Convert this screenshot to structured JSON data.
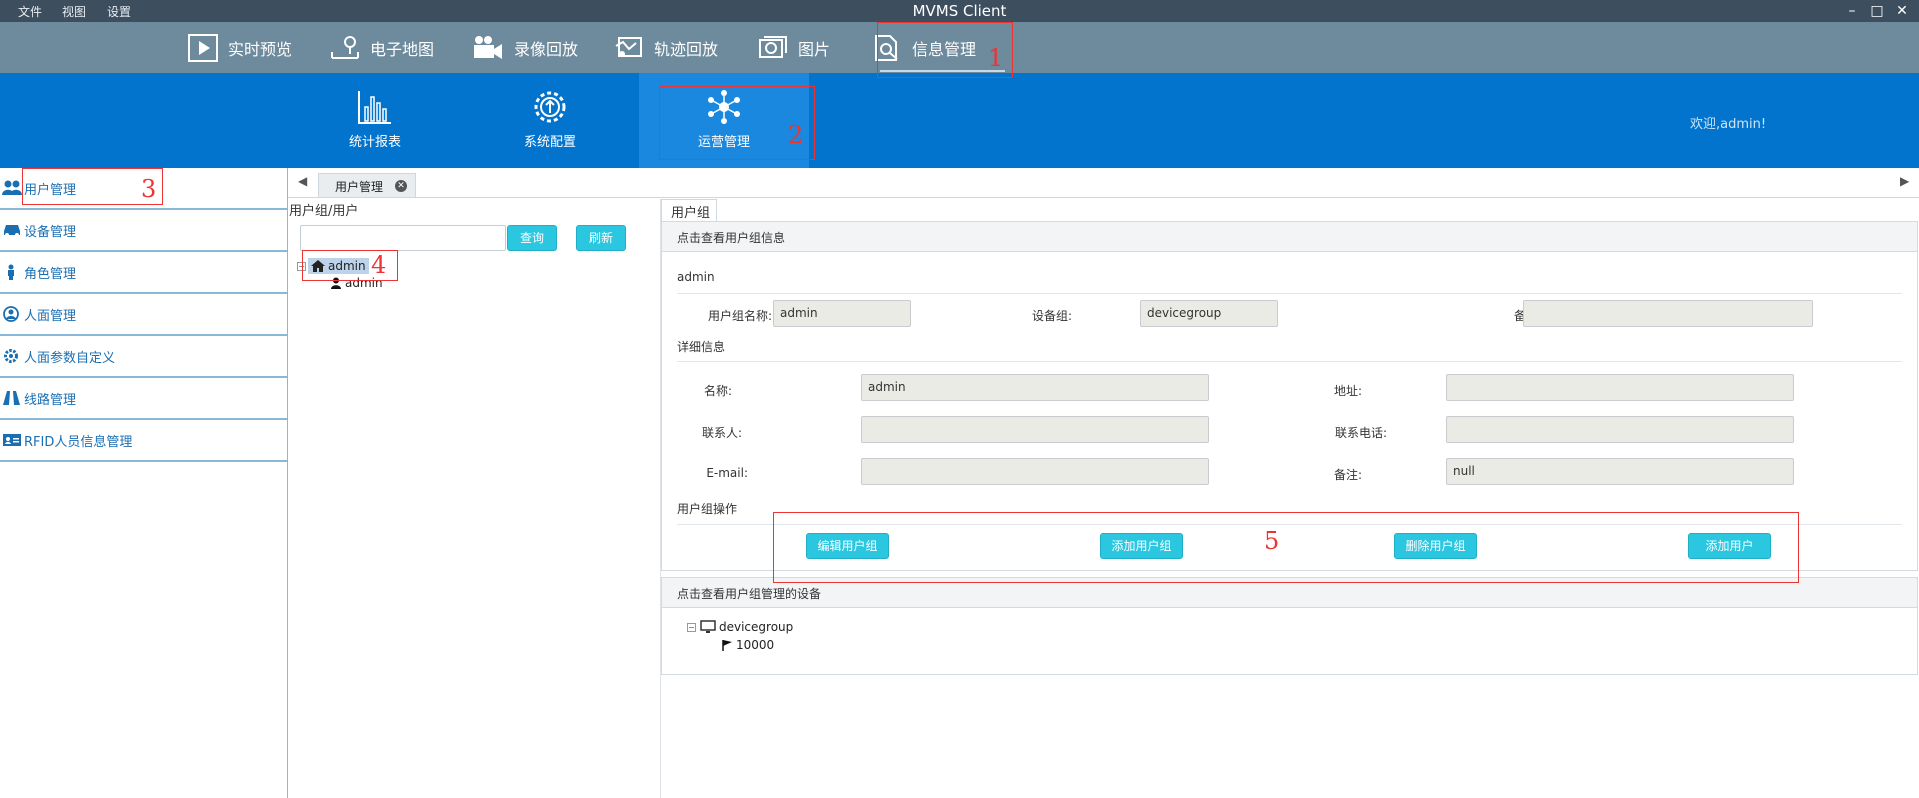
{
  "window": {
    "title": "MVMS Client",
    "menu": [
      "文件",
      "视图",
      "设置"
    ]
  },
  "topnav": {
    "items": [
      "实时预览",
      "电子地图",
      "录像回放",
      "轨迹回放",
      "图片",
      "信息管理"
    ]
  },
  "subnav": {
    "items": [
      "统计报表",
      "系统配置",
      "运营管理"
    ],
    "welcome": "欢迎,admin!"
  },
  "annotations": [
    "1",
    "2",
    "3",
    "4",
    "5"
  ],
  "sidebar": {
    "items": [
      "用户管理",
      "设备管理",
      "角色管理",
      "人面管理",
      "人面参数自定义",
      "线路管理",
      "RFID人员信息管理"
    ]
  },
  "tabs": {
    "active": "用户管理"
  },
  "tree": {
    "title": "用户组/用户",
    "search_value": "",
    "query_label": "查询",
    "refresh_label": "刷新",
    "group": "admin",
    "user": "admin"
  },
  "content": {
    "tab_label": "用户组",
    "group_info_header": "点击查看用户组信息",
    "group_name_heading": "admin",
    "group_name_label": "用户组名称:",
    "group_name_value": "admin",
    "device_group_label": "设备组:",
    "device_group_value": "devicegroup",
    "remark_label": "备注:",
    "remark_value": "",
    "detail_heading": "详细信息",
    "name_label": "名称:",
    "name_value": "admin",
    "address_label": "地址:",
    "address_value": "",
    "contact_label": "联系人:",
    "contact_value": "",
    "phone_label": "联系电话:",
    "phone_value": "",
    "email_label": "E-mail:",
    "email_value": "",
    "remark2_label": "备注:",
    "remark2_value": "null",
    "ops_heading": "用户组操作",
    "ops_buttons": [
      "编辑用户组",
      "添加用户组",
      "删除用户组",
      "添加用户"
    ],
    "devices_header": "点击查看用户组管理的设备",
    "device_tree_group": "devicegroup",
    "device_tree_item": "10000"
  }
}
